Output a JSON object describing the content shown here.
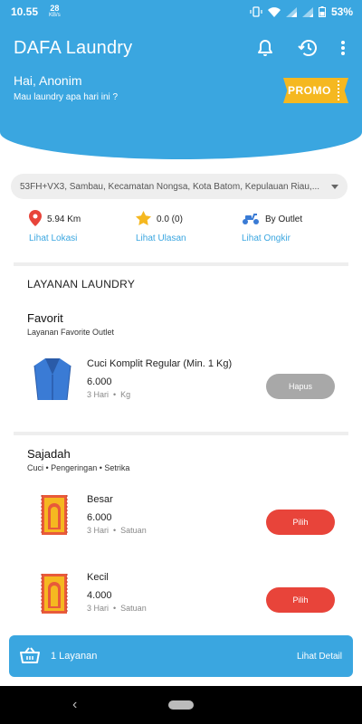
{
  "status_bar": {
    "time": "10.55",
    "net_speed": "28",
    "net_unit": "KB/s",
    "battery": "53%"
  },
  "header": {
    "title": "DAFA Laundry",
    "greeting": "Hai, Anonim",
    "subtitle": "Mau laundry apa hari ini ?",
    "promo_label": "PROMO"
  },
  "address": {
    "value": "53FH+VX3, Sambau, Kecamatan Nongsa, Kota Batom, Kepulauan Riau,..."
  },
  "info": {
    "distance": "5.94 Km",
    "distance_link": "Lihat Lokasi",
    "rating": "0.0 (0)",
    "rating_link": "Lihat Ulasan",
    "delivery": "By Outlet",
    "delivery_link": "Lihat Ongkir"
  },
  "section_title": "LAYANAN LAUNDRY",
  "favorit": {
    "title": "Favorit",
    "subtitle": "Layanan Favorite Outlet",
    "item": {
      "name": "Cuci Komplit Regular (Min. 1 Kg)",
      "price": "6.000",
      "duration": "3 Hari",
      "unit": "Kg",
      "button": "Hapus"
    }
  },
  "sajadah": {
    "title": "Sajadah",
    "subtitle": "Cuci • Pengeringan • Setrika",
    "items": [
      {
        "name": "Besar",
        "price": "6.000",
        "duration": "3 Hari",
        "unit": "Satuan",
        "button": "Pilih"
      },
      {
        "name": "Kecil",
        "price": "4.000",
        "duration": "3 Hari",
        "unit": "Satuan",
        "button": "Pilih"
      }
    ]
  },
  "cart": {
    "count_label": "1 Layanan",
    "detail_label": "Lihat Detail"
  },
  "icons": {
    "bell": "bell-icon",
    "history": "history-icon",
    "menu": "more-vertical-icon",
    "location": "location-pin-icon",
    "star": "star-icon",
    "scooter": "scooter-icon",
    "basket": "basket-icon"
  },
  "colors": {
    "primary": "#3aa6e0",
    "promo": "#f5b820",
    "danger": "#e8443a",
    "muted_button": "#a8a8a8"
  }
}
